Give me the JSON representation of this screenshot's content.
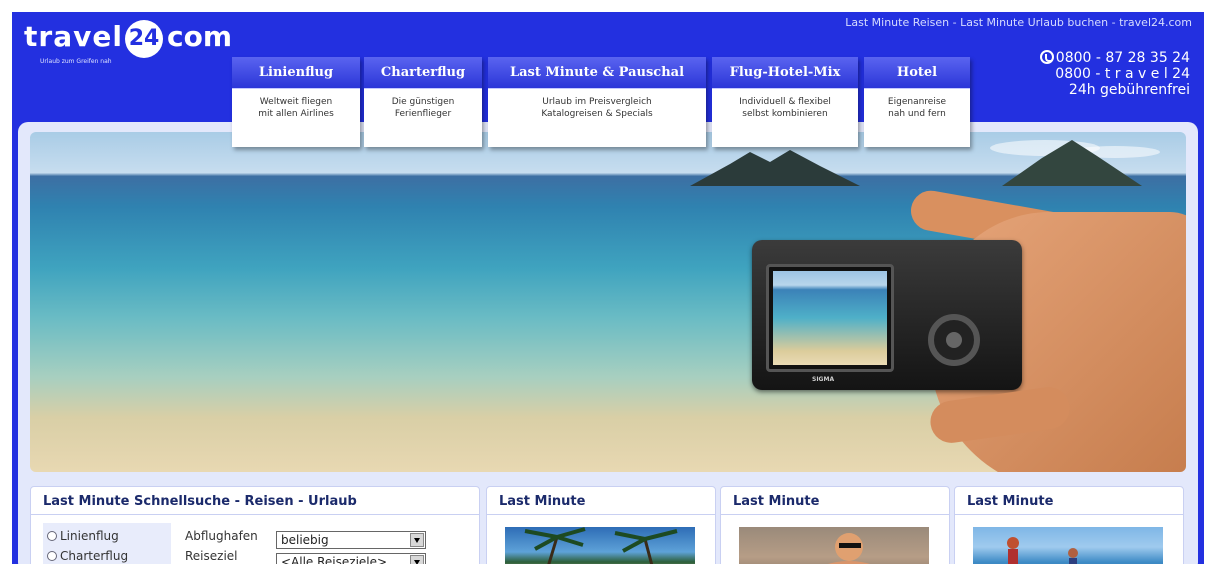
{
  "header": {
    "logo_text": "travel",
    "logo_number": "24",
    "logo_com": "com",
    "logo_slogan": "Urlaub zum Greifen nah",
    "tagline": "Last Minute Reisen - Last Minute Urlaub buchen - travel24.com",
    "hotline": {
      "line1": "0800 - 87 28 35 24",
      "line2": "0800 - t r a v e l 24",
      "line3": "24h gebührenfrei"
    }
  },
  "nav": [
    {
      "label": "Linienflug",
      "desc": "Weltweit fliegen\nmit allen Airlines"
    },
    {
      "label": "Charterflug",
      "desc": "Die günstigen\nFerienflieger"
    },
    {
      "label": "Last Minute & Pauschal",
      "desc": "Urlaub im Preisvergleich\nKatalogreisen & Specials"
    },
    {
      "label": "Flug-Hotel-Mix",
      "desc": "Individuell & flexibel\nselbst kombinieren"
    },
    {
      "label": "Hotel",
      "desc": "Eigenanreise\nnah und fern"
    }
  ],
  "hero": {
    "camera_brand": "SIGMA"
  },
  "search": {
    "title": "Last Minute Schnellsuche - Reisen - Urlaub",
    "options": [
      "Linienflug",
      "Charterflug"
    ],
    "departure_label": "Abflughafen",
    "departure_value": "beliebig",
    "destination_label": "Reiseziel",
    "destination_value": "<Alle Reiseziele>"
  },
  "offers": [
    {
      "title": "Last Minute"
    },
    {
      "title": "Last Minute"
    },
    {
      "title": "Last Minute"
    }
  ],
  "colors": {
    "brand_blue": "#2330e0",
    "panel": "#e3e8fb",
    "heading": "#1b2a6b"
  }
}
